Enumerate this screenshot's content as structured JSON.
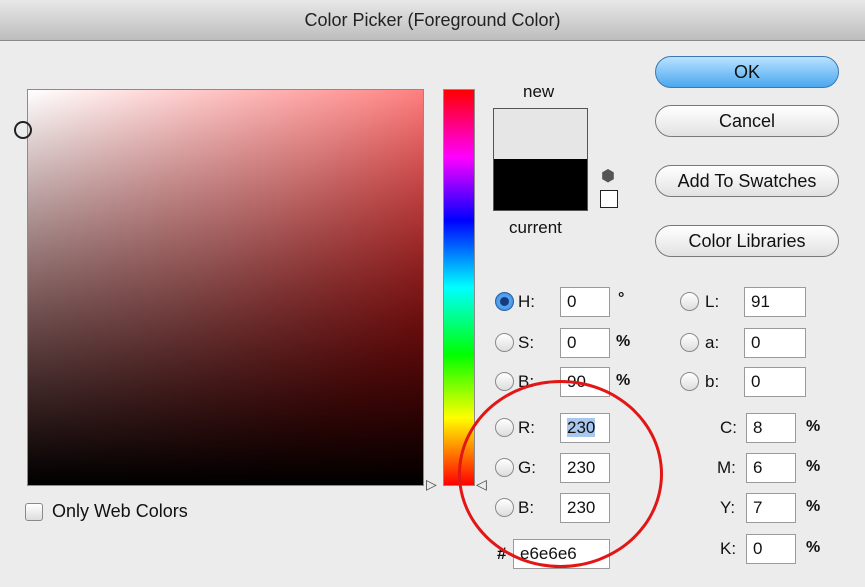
{
  "window": {
    "title": "Color Picker (Foreground Color)"
  },
  "colors": {
    "accent_button": "#4aa7ef",
    "new_color": "#e6e6e6",
    "current_color": "#000000",
    "annotation": "#e31616"
  },
  "swatch": {
    "new_label": "new",
    "current_label": "current"
  },
  "buttons": {
    "ok": "OK",
    "cancel": "Cancel",
    "add_to_swatches": "Add To Swatches",
    "color_libraries": "Color Libraries"
  },
  "hsb": {
    "h_label": "H:",
    "h_value": "0",
    "h_unit": "°",
    "s_label": "S:",
    "s_value": "0",
    "s_unit": "%",
    "b_label": "B:",
    "b_value": "90",
    "b_unit": "%",
    "selected": "H"
  },
  "rgb": {
    "r_label": "R:",
    "r_value": "230",
    "g_label": "G:",
    "g_value": "230",
    "b_label": "B:",
    "b_value": "230"
  },
  "lab": {
    "l_label": "L:",
    "l_value": "91",
    "a_label": "a:",
    "a_value": "0",
    "b_label": "b:",
    "b_value": "0"
  },
  "cmyk": {
    "c_label": "C:",
    "c_value": "8",
    "c_unit": "%",
    "m_label": "M:",
    "m_value": "6",
    "m_unit": "%",
    "y_label": "Y:",
    "y_value": "7",
    "y_unit": "%",
    "k_label": "K:",
    "k_value": "0",
    "k_unit": "%"
  },
  "hex": {
    "label": "#",
    "value": "e6e6e6"
  },
  "web_colors": {
    "label": "Only Web Colors",
    "checked": false
  },
  "icons": [
    "gamut-cube-icon",
    "web-safe-square-icon",
    "hue-slider-arrow-icon"
  ]
}
